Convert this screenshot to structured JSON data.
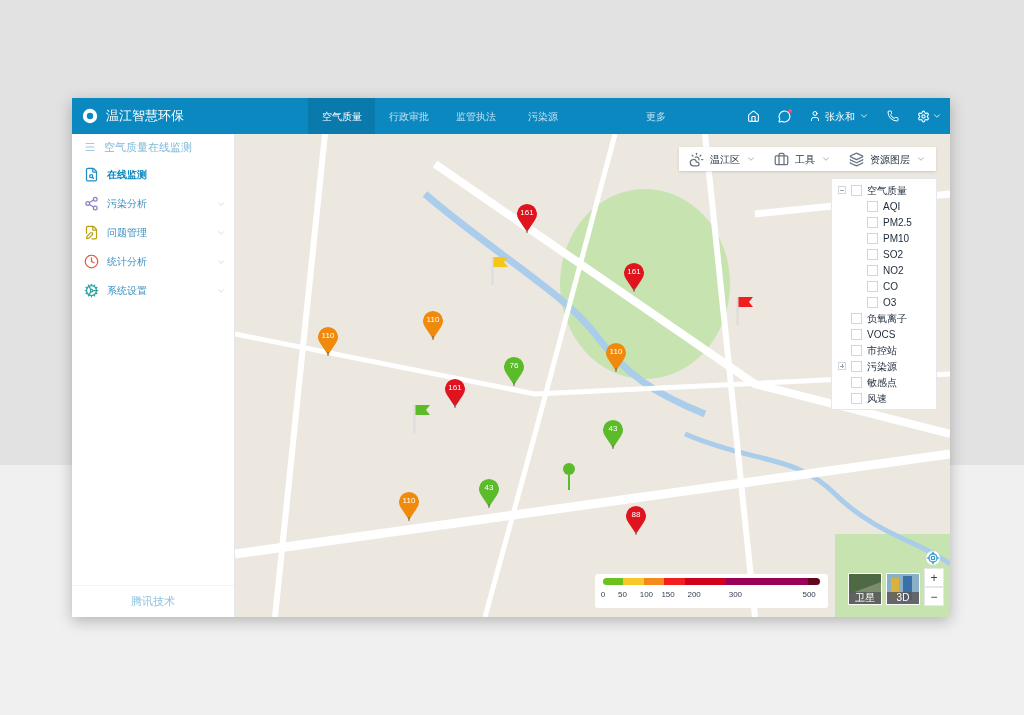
{
  "header": {
    "title": "温江智慧环保",
    "nav": [
      {
        "label": "空气质量",
        "selected": true
      },
      {
        "label": "行政审批",
        "selected": false
      },
      {
        "label": "监管执法",
        "selected": false
      },
      {
        "label": "污染源",
        "selected": false
      },
      {
        "label": "更多",
        "selected": false
      }
    ],
    "user": "张永和",
    "has_notification": true
  },
  "sidebar": {
    "title": "空气质量在线监测",
    "items": [
      {
        "label": "在线监测",
        "kind": "monitor",
        "selected": true,
        "has_children": false
      },
      {
        "label": "污染分析",
        "kind": "analysis",
        "selected": false,
        "has_children": true
      },
      {
        "label": "问题管理",
        "kind": "issues",
        "selected": false,
        "has_children": true
      },
      {
        "label": "统计分析",
        "kind": "stats",
        "selected": false,
        "has_children": true
      },
      {
        "label": "系统设置",
        "kind": "settings",
        "selected": false,
        "has_children": true
      }
    ],
    "footer": "腾讯技术"
  },
  "toolbar": [
    {
      "label": "温江区",
      "kind": "weather"
    },
    {
      "label": "工具",
      "kind": "tools"
    },
    {
      "label": "资源图层",
      "kind": "layers"
    }
  ],
  "layers": [
    {
      "label": "空气质量",
      "checked": false,
      "expanded": true,
      "children": [
        {
          "label": "AQI",
          "checked": false
        },
        {
          "label": "PM2.5",
          "checked": false
        },
        {
          "label": "PM10",
          "checked": false
        },
        {
          "label": "SO2",
          "checked": false
        },
        {
          "label": "NO2",
          "checked": false
        },
        {
          "label": "CO",
          "checked": false
        },
        {
          "label": "O3",
          "checked": false
        }
      ]
    },
    {
      "label": "负氧离子",
      "checked": false
    },
    {
      "label": "VOCS",
      "checked": false
    },
    {
      "label": "市控站",
      "checked": false
    },
    {
      "label": "污染源",
      "checked": false,
      "expanded": false
    },
    {
      "label": "敏感点",
      "checked": false
    },
    {
      "label": "风速",
      "checked": false
    }
  ],
  "markers": [
    {
      "kind": "pin",
      "value": "161",
      "color": "#e0141e"
    },
    {
      "kind": "pin",
      "value": "161",
      "color": "#e0141e"
    },
    {
      "kind": "pin",
      "value": "110",
      "color": "#f08a0c"
    },
    {
      "kind": "pin",
      "value": "110",
      "color": "#f08a0c"
    },
    {
      "kind": "pin",
      "value": "110",
      "color": "#f08a0c"
    },
    {
      "kind": "pin",
      "value": "76",
      "color": "#5cbb2a"
    },
    {
      "kind": "pin",
      "value": "161",
      "color": "#e0141e"
    },
    {
      "kind": "pin",
      "value": "43",
      "color": "#5cbb2a"
    },
    {
      "kind": "pin",
      "value": "43",
      "color": "#5cbb2a"
    },
    {
      "kind": "pin",
      "value": "110",
      "color": "#f08a0c"
    },
    {
      "kind": "pin",
      "value": "88",
      "color": "#e0141e"
    },
    {
      "kind": "flag",
      "color": "#f5c518"
    },
    {
      "kind": "flag",
      "color": "#f01e1e"
    },
    {
      "kind": "flag",
      "color": "#5cbb2a"
    },
    {
      "kind": "dot",
      "color": "#5cbb2a"
    }
  ],
  "legend": {
    "segments": [
      {
        "color": "#6cc11f"
      },
      {
        "color": "#f8c72a"
      },
      {
        "color": "#f5891c"
      },
      {
        "color": "#f51e1e"
      },
      {
        "color": "#d1001c"
      },
      {
        "color": "#990057"
      },
      {
        "color": "#61081e"
      }
    ],
    "labels": [
      "0",
      "50",
      "100",
      "150",
      "200",
      "300",
      "500"
    ]
  },
  "map_types": [
    {
      "label": "卫星"
    },
    {
      "label": "3D"
    }
  ],
  "zoom": [
    "+",
    "−"
  ]
}
